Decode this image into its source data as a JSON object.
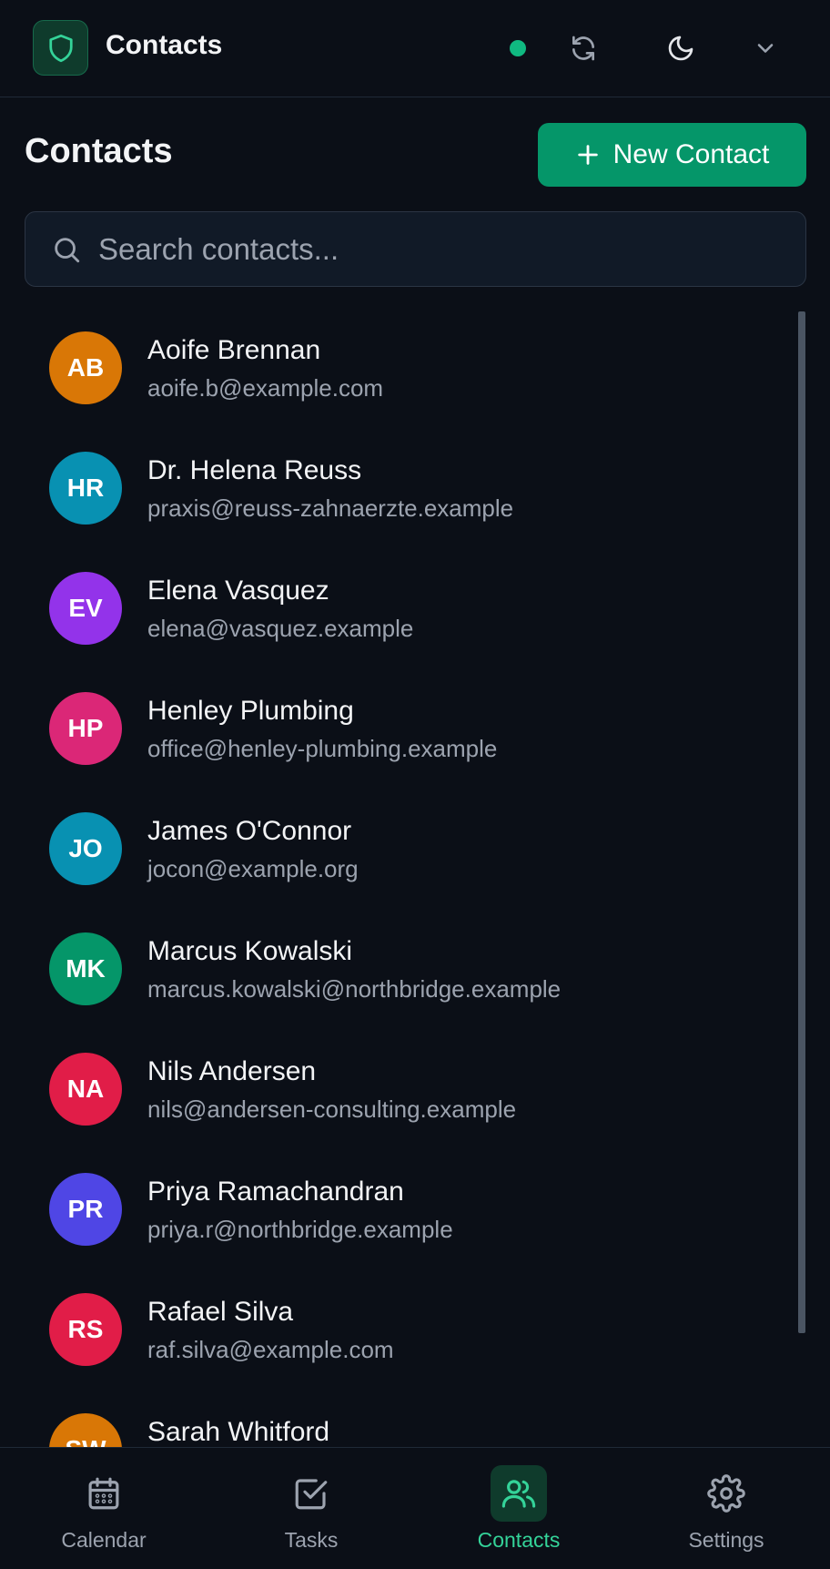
{
  "header": {
    "app_title": "Contacts",
    "status_color": "#10b981",
    "icons": [
      "shield-icon",
      "refresh-icon",
      "moon-icon",
      "chevron-down-icon"
    ]
  },
  "page": {
    "title": "Contacts",
    "new_contact_label": "New Contact"
  },
  "search": {
    "placeholder": "Search contacts..."
  },
  "contacts": [
    {
      "initials": "AB",
      "name": "Aoife Brennan",
      "email": "aoife.b@example.com",
      "color": "#d97706"
    },
    {
      "initials": "HR",
      "name": "Dr. Helena Reuss",
      "email": "praxis@reuss-zahnaerzte.example",
      "color": "#0891b2"
    },
    {
      "initials": "EV",
      "name": "Elena Vasquez",
      "email": "elena@vasquez.example",
      "color": "#9333ea"
    },
    {
      "initials": "HP",
      "name": "Henley Plumbing",
      "email": "office@henley-plumbing.example",
      "color": "#db2777"
    },
    {
      "initials": "JO",
      "name": "James O'Connor",
      "email": "jocon@example.org",
      "color": "#0891b2"
    },
    {
      "initials": "MK",
      "name": "Marcus Kowalski",
      "email": "marcus.kowalski@northbridge.example",
      "color": "#059669"
    },
    {
      "initials": "NA",
      "name": "Nils Andersen",
      "email": "nils@andersen-consulting.example",
      "color": "#e11d48"
    },
    {
      "initials": "PR",
      "name": "Priya Ramachandran",
      "email": "priya.r@northbridge.example",
      "color": "#4f46e5"
    },
    {
      "initials": "RS",
      "name": "Rafael Silva",
      "email": "raf.silva@example.com",
      "color": "#e11d48"
    },
    {
      "initials": "SW",
      "name": "Sarah Whitford",
      "email": "",
      "color": "#d97706"
    }
  ],
  "nav": {
    "calendar": "Calendar",
    "tasks": "Tasks",
    "contacts": "Contacts",
    "settings": "Settings",
    "active": "contacts",
    "accent_color": "#34d399"
  }
}
